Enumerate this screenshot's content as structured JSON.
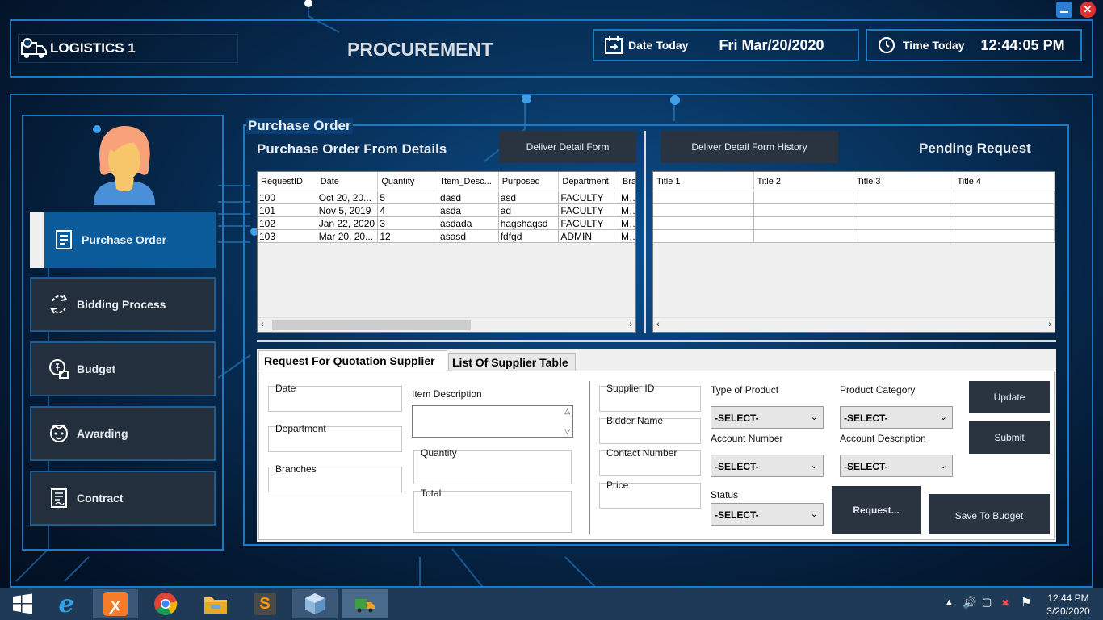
{
  "window": {
    "minimize_icon": "minimize-icon",
    "close_icon": "close-icon"
  },
  "header": {
    "app_name": "LOGISTICS 1",
    "module_title": "PROCUREMENT",
    "date_label": "Date Today",
    "date_value": "Fri Mar/20/2020",
    "time_label": "Time Today",
    "time_value": "12:44:05 PM"
  },
  "sidebar": {
    "items": [
      {
        "label": "Purchase Order",
        "icon": "document-list-icon",
        "active": true
      },
      {
        "label": "Bidding Process",
        "icon": "refresh-cycle-icon"
      },
      {
        "label": "Budget",
        "icon": "budget-icon"
      },
      {
        "label": "Awarding",
        "icon": "person-award-icon"
      },
      {
        "label": "Contract",
        "icon": "contract-icon"
      }
    ]
  },
  "main": {
    "section_title": "Purchase Order",
    "po_details_title": "Purchase Order From Details",
    "deliver_detail_form_btn": "Deliver Detail Form",
    "deliver_history_btn": "Deliver Detail Form History",
    "pending_title": "Pending Request",
    "po_table": {
      "columns": [
        "RequestID",
        "Date",
        "Quantity",
        "Item_Desc...",
        "Purposed",
        "Department",
        "Bra"
      ],
      "rows": [
        [
          "100",
          "Oct 20, 20...",
          "5",
          "dasd",
          "asd",
          "FACULTY",
          "MA"
        ],
        [
          "101",
          "Nov 5, 2019",
          "4",
          "asda",
          "ad",
          "FACULTY",
          "MV"
        ],
        [
          "102",
          "Jan 22, 2020",
          "3",
          "asdada",
          "hagshagsd",
          "FACULTY",
          "MA"
        ],
        [
          "103",
          "Mar 20, 20...",
          "12",
          "asasd",
          "fdfgd",
          "ADMIN",
          "MV"
        ]
      ]
    },
    "pending_table": {
      "columns": [
        "Title 1",
        "Title 2",
        "Title 3",
        "Title 4"
      ],
      "rows": [
        [
          "",
          "",
          "",
          ""
        ],
        [
          "",
          "",
          "",
          ""
        ],
        [
          "",
          "",
          "",
          ""
        ],
        [
          "",
          "",
          "",
          ""
        ]
      ]
    }
  },
  "form": {
    "tabs": [
      "Request For Quotation Supplier",
      "List Of Supplier Table"
    ],
    "date_label": "Date",
    "department_label": "Department",
    "branches_label": "Branches",
    "item_description_label": "Item Description",
    "quantity_label": "Quantity",
    "total_label": "Total",
    "supplier_id_label": "Supplier ID",
    "bidder_name_label": "Bidder Name",
    "contact_number_label": "Contact Number",
    "price_label": "Price",
    "type_of_product_label": "Type of Product",
    "product_category_label": "Product Category",
    "account_number_label": "Account Number",
    "account_description_label": "Account Description",
    "status_label": "Status",
    "select_value": "-SELECT-",
    "update_btn": "Update",
    "submit_btn": "Submit",
    "request_btn": "Request...",
    "save_budget_btn": "Save To Budget"
  },
  "taskbar": {
    "apps": [
      "windows-start-icon",
      "internet-explorer-icon",
      "xampp-icon",
      "chrome-icon",
      "file-explorer-icon",
      "sublime-text-icon",
      "virtualbox-icon",
      "logistics-app-icon"
    ],
    "clock_time": "12:44 PM",
    "clock_date": "3/20/2020"
  }
}
